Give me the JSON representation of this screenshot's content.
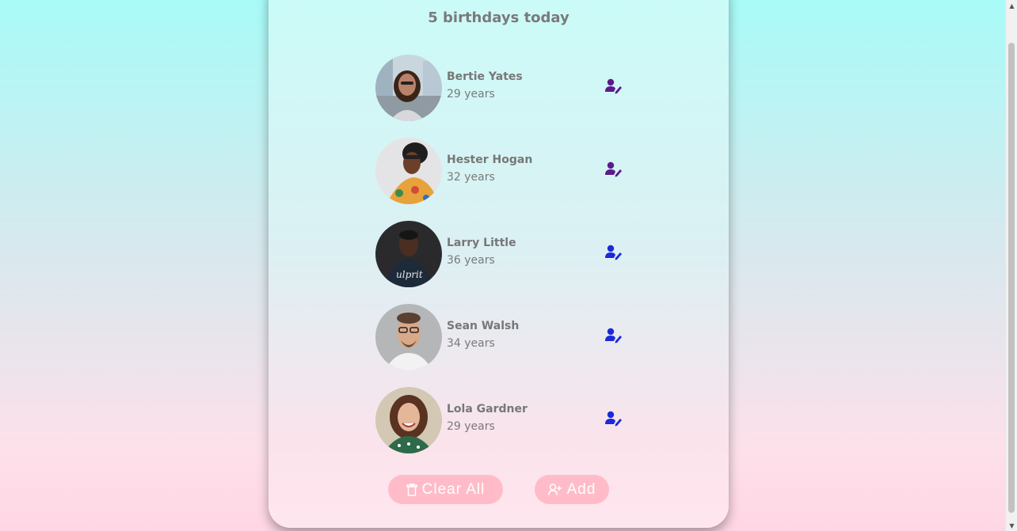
{
  "header": {
    "title": "5 birthdays today"
  },
  "people": [
    {
      "name": "Bertie Yates",
      "age": "29 years",
      "icon_color": "#5a1c8c"
    },
    {
      "name": "Hester Hogan",
      "age": "32 years",
      "icon_color": "#5a1c8c"
    },
    {
      "name": "Larry Little",
      "age": "36 years",
      "icon_color": "#1a2ad8"
    },
    {
      "name": "Sean Walsh",
      "age": "34 years",
      "icon_color": "#1a2ad8"
    },
    {
      "name": "Lola Gardner",
      "age": "29 years",
      "icon_color": "#1a2ad8"
    }
  ],
  "actions": {
    "clear_label": "Clear All",
    "clear_icon": "trash-icon",
    "add_label": "Add",
    "add_icon": "user-plus-icon"
  },
  "colors": {
    "button_bg": "#ffbcc8",
    "title_text": "#7a7a7a"
  }
}
